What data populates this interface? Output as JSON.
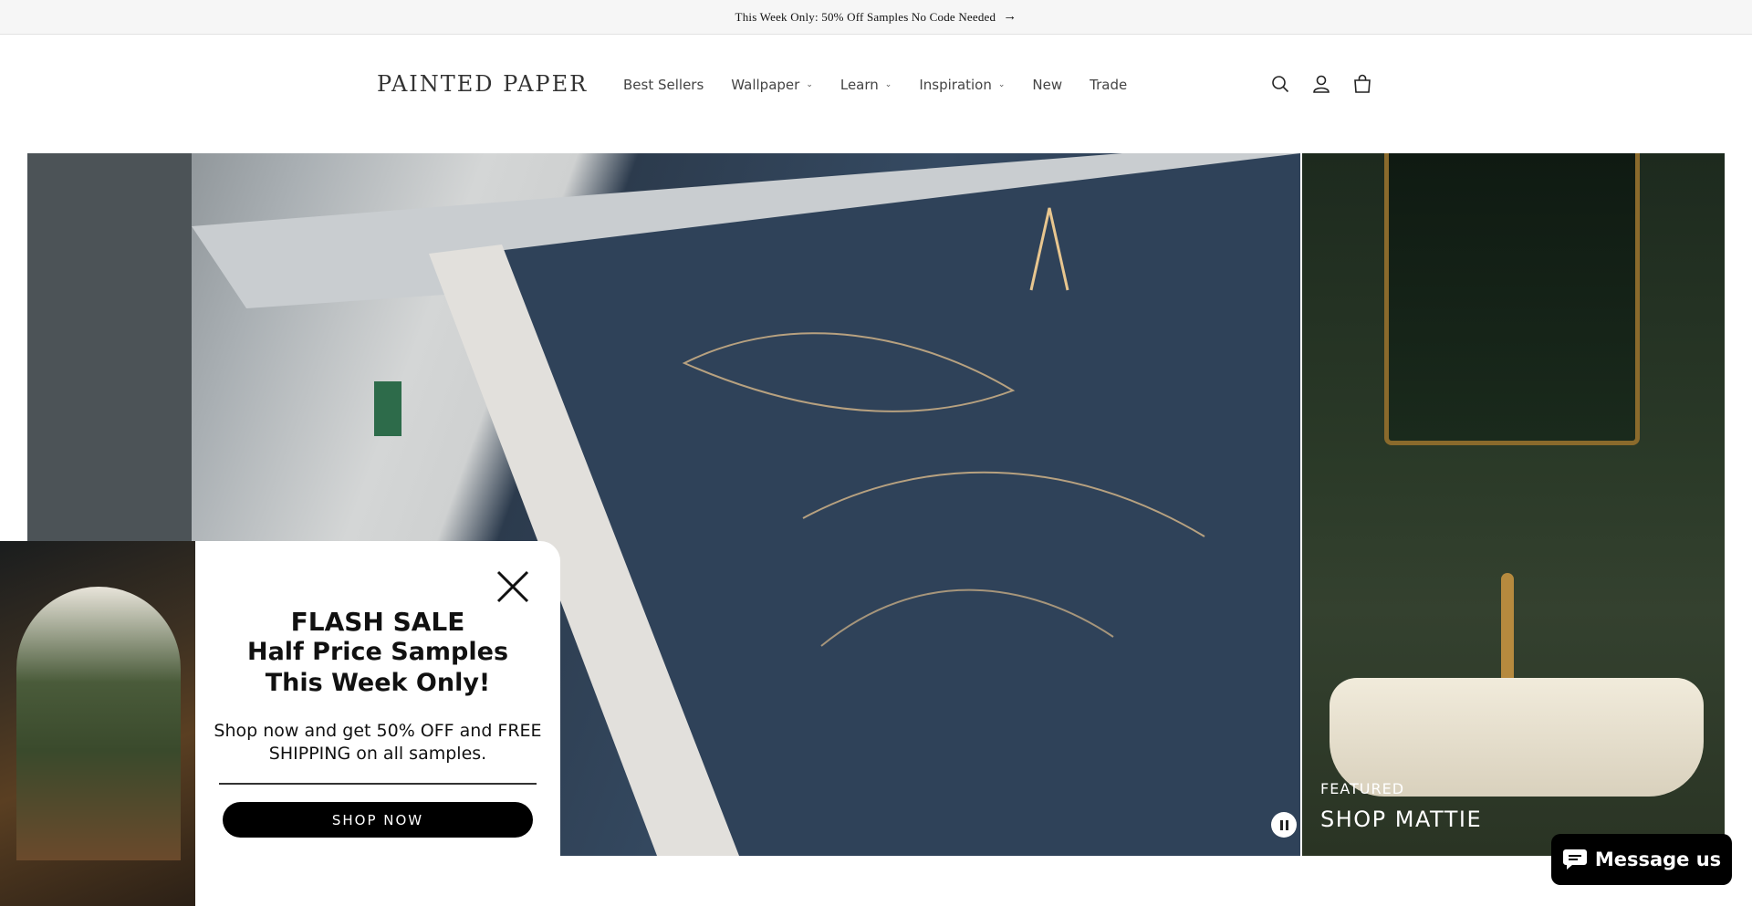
{
  "announcement": {
    "text": "This Week Only: 50% Off Samples No Code Needed",
    "arrow": "→"
  },
  "header": {
    "logo": "PAINTED PAPER",
    "nav": [
      {
        "label": "Best Sellers",
        "dropdown": false
      },
      {
        "label": "Wallpaper",
        "dropdown": true
      },
      {
        "label": "Learn",
        "dropdown": true
      },
      {
        "label": "Inspiration",
        "dropdown": true
      },
      {
        "label": "New",
        "dropdown": false
      },
      {
        "label": "Trade",
        "dropdown": false
      }
    ],
    "icons": [
      "search-icon",
      "account-icon",
      "cart-icon"
    ]
  },
  "hero": {
    "featured_label": "FEATURED",
    "featured_title": "SHOP MATTIE"
  },
  "popup": {
    "line1": "FLASH SALE",
    "line2": "Half Price Samples",
    "line3": "This Week Only!",
    "body": "Shop now and get 50% OFF and FREE SHIPPING on all samples.",
    "button": "SHOP NOW"
  },
  "chat": {
    "label": "Message us"
  }
}
